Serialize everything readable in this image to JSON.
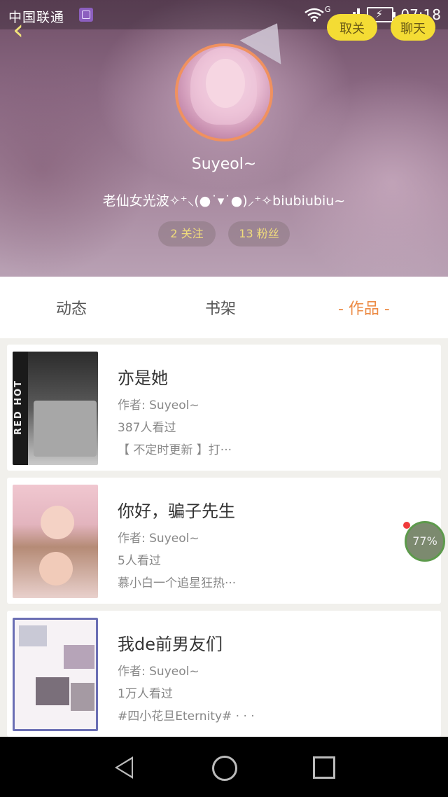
{
  "status_bar": {
    "carrier": "中国联通",
    "network": "G",
    "time": "07:18"
  },
  "header": {
    "top_buttons": [
      "取关",
      "聊天"
    ],
    "username": "Suyeol~",
    "bio": "老仙女光波✧⁺⸜(●˙▾˙●)⸝⁺✧biubiubiu~",
    "following": "2 关注",
    "followers": "13 粉丝"
  },
  "tabs": [
    {
      "label": "动态",
      "active": false
    },
    {
      "label": "书架",
      "active": false
    },
    {
      "label": "- 作品 -",
      "active": true
    }
  ],
  "works": [
    {
      "title": "亦是她",
      "author": "作者: Suyeol~",
      "views": "387人看过",
      "description": "【 不定时更新 】打···"
    },
    {
      "title": "你好，骗子先生",
      "author": "作者: Suyeol~",
      "views": "5人看过",
      "description": "慕小白一个追星狂热···"
    },
    {
      "title": "我de前男友们",
      "author": "作者: Suyeol~",
      "views": "1万人看过",
      "description": "#四小花旦Eternity#      · · ·"
    }
  ],
  "floating_badge": {
    "percent": "77%"
  },
  "colors": {
    "accent": "#ec8b45",
    "yellow": "#f4dc34"
  }
}
